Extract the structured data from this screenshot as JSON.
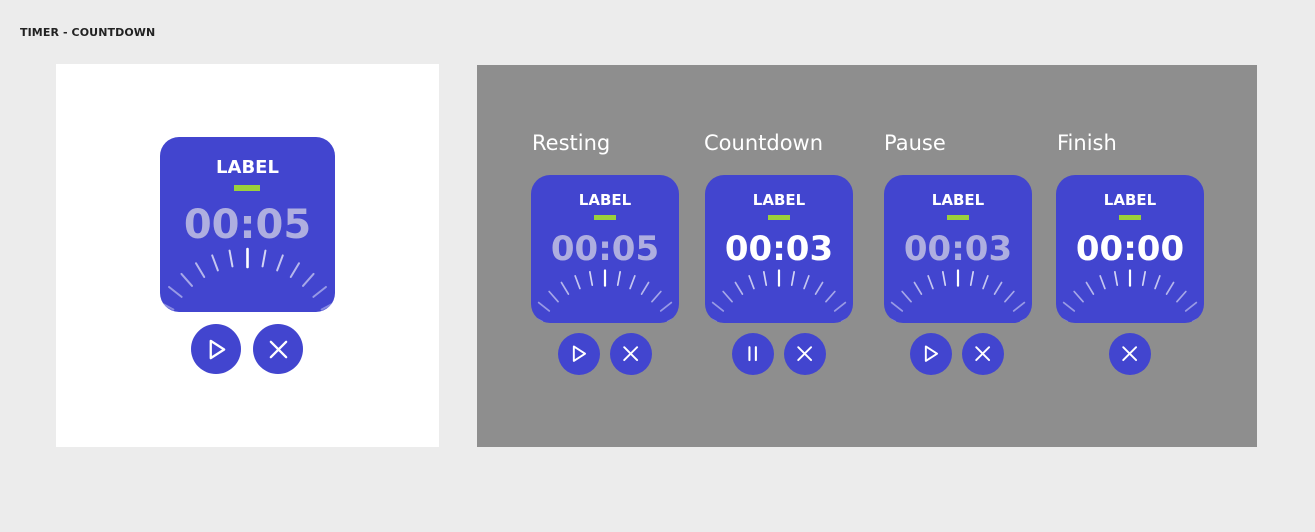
{
  "page": {
    "title": "TIMER - COUNTDOWN"
  },
  "colors": {
    "background": "#ececec",
    "card": "#4245cf",
    "accent_bar": "#9bd03c",
    "text_active": "#ffffff",
    "text_inactive": "#aeaee0",
    "gray_panel": "#8e8e8e"
  },
  "preview": {
    "label": "LABEL",
    "time": "00:05",
    "time_state": "inactive",
    "buttons": [
      "play-icon",
      "close-icon"
    ]
  },
  "states": [
    {
      "title": "Resting",
      "label": "LABEL",
      "time": "00:05",
      "time_state": "inactive",
      "buttons": [
        "play-icon",
        "close-icon"
      ]
    },
    {
      "title": "Countdown",
      "label": "LABEL",
      "time": "00:03",
      "time_state": "active",
      "buttons": [
        "pause-icon",
        "close-icon"
      ]
    },
    {
      "title": "Pause",
      "label": "LABEL",
      "time": "00:03",
      "time_state": "inactive",
      "buttons": [
        "play-icon",
        "close-icon"
      ]
    },
    {
      "title": "Finish",
      "label": "LABEL",
      "time": "00:00",
      "time_state": "active",
      "buttons": [
        "close-icon"
      ]
    }
  ]
}
